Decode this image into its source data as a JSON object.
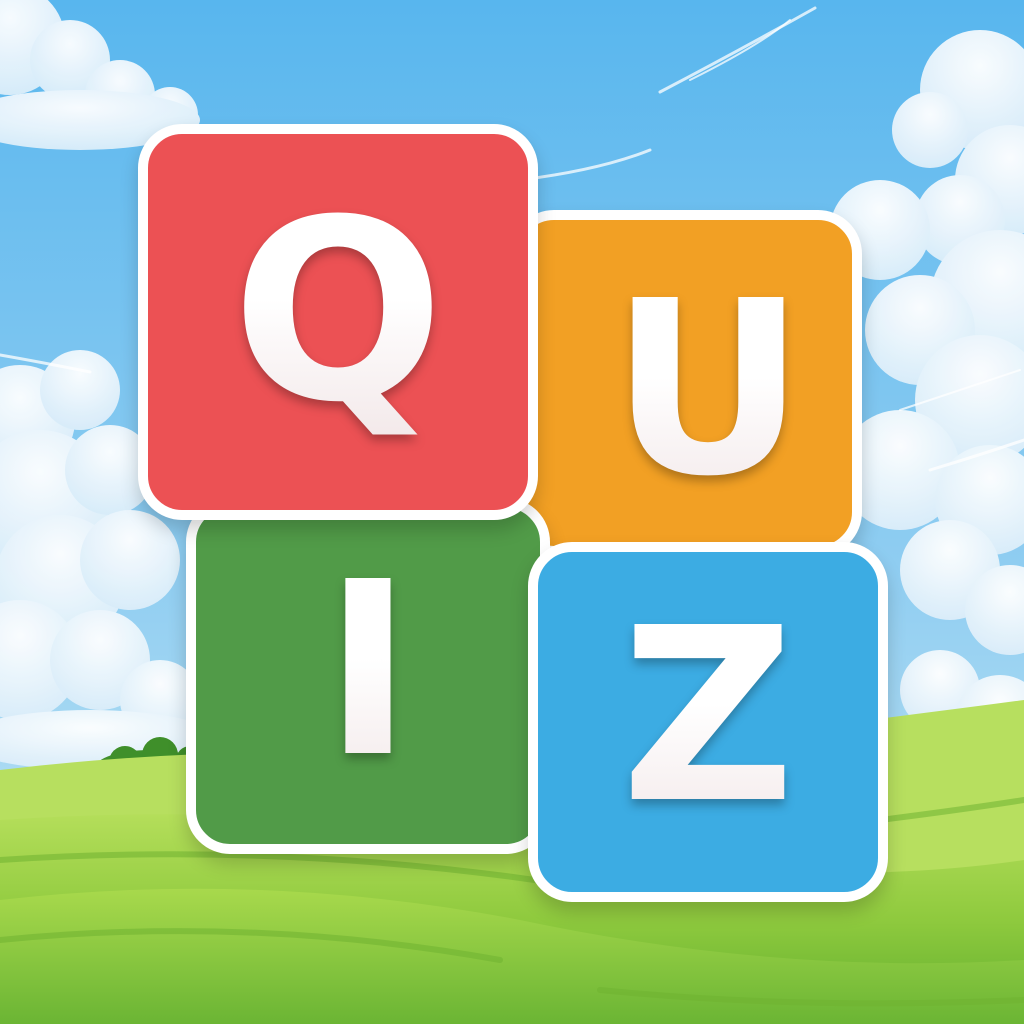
{
  "title_tiles": [
    {
      "letter": "Q",
      "color": "#ec5154"
    },
    {
      "letter": "U",
      "color": "#f2a024"
    },
    {
      "letter": "I",
      "color": "#519b48"
    },
    {
      "letter": "Z",
      "color": "#3cace3"
    }
  ],
  "colors": {
    "sky_top": "#5bb7ee",
    "sky_bottom": "#bfe4f6",
    "grass_light": "#a5d84a",
    "grass_dark": "#5fae2e",
    "tile_border": "#ffffff"
  }
}
